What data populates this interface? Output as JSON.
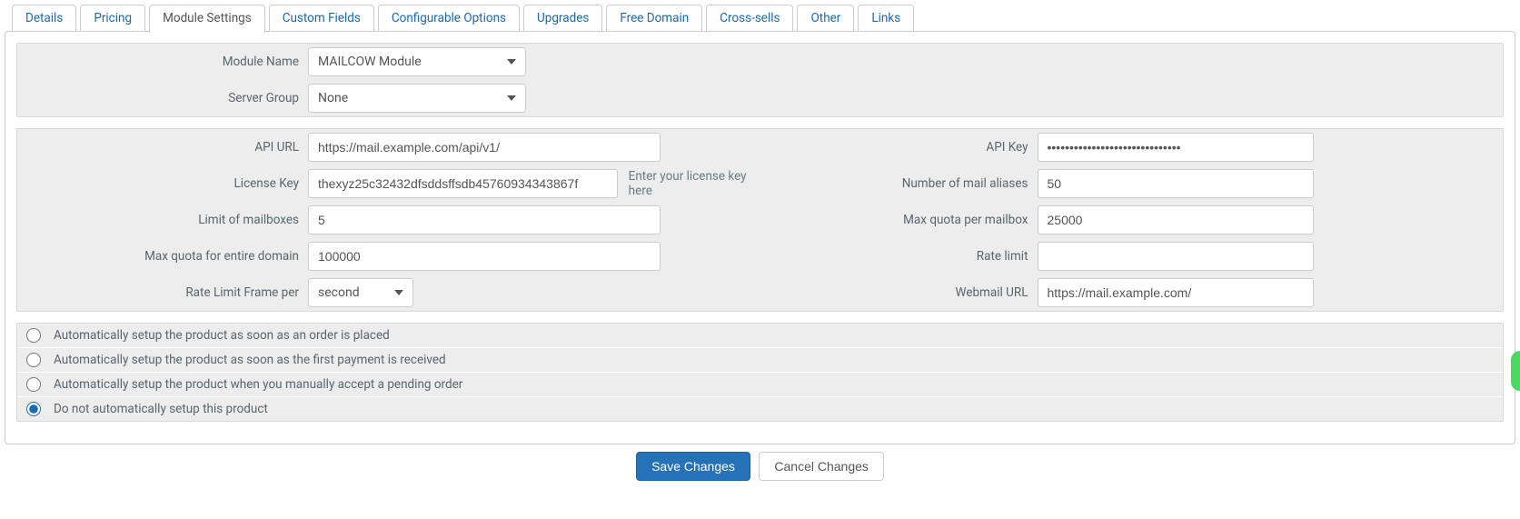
{
  "tabs": {
    "items": [
      {
        "label": "Details"
      },
      {
        "label": "Pricing"
      },
      {
        "label": "Module Settings"
      },
      {
        "label": "Custom Fields"
      },
      {
        "label": "Configurable Options"
      },
      {
        "label": "Upgrades"
      },
      {
        "label": "Free Domain"
      },
      {
        "label": "Cross-sells"
      },
      {
        "label": "Other"
      },
      {
        "label": "Links"
      }
    ],
    "active_index": 2
  },
  "top_section": {
    "module_name": {
      "label": "Module Name",
      "value": "MAILCOW Module"
    },
    "server_group": {
      "label": "Server Group",
      "value": "None"
    }
  },
  "settings": {
    "left": {
      "api_url": {
        "label": "API URL",
        "value": "https://mail.example.com/api/v1/"
      },
      "license": {
        "label": "License Key",
        "value": "thexyz25c32432dfsddsffsdb45760934343867f",
        "help": "Enter your license key here"
      },
      "limit_mbx": {
        "label": "Limit of mailboxes",
        "value": "5"
      },
      "max_quota": {
        "label": "Max quota for entire domain",
        "value": "100000"
      },
      "rate_frame": {
        "label": "Rate Limit Frame per",
        "value": "second"
      }
    },
    "right": {
      "api_key": {
        "label": "API Key",
        "value": "••••••••••••••••••••••••••••••"
      },
      "aliases": {
        "label": "Number of mail aliases",
        "value": "50"
      },
      "mbx_quota": {
        "label": "Max quota per mailbox",
        "value": "25000"
      },
      "rate_limit": {
        "label": "Rate limit",
        "value": ""
      },
      "webmail": {
        "label": "Webmail URL",
        "value": "https://mail.example.com/"
      }
    }
  },
  "auto_setup": {
    "options": [
      "Automatically setup the product as soon as an order is placed",
      "Automatically setup the product as soon as the first payment is received",
      "Automatically setup the product when you manually accept a pending order",
      "Do not automatically setup this product"
    ],
    "selected_index": 3
  },
  "buttons": {
    "save": "Save Changes",
    "cancel": "Cancel Changes"
  }
}
